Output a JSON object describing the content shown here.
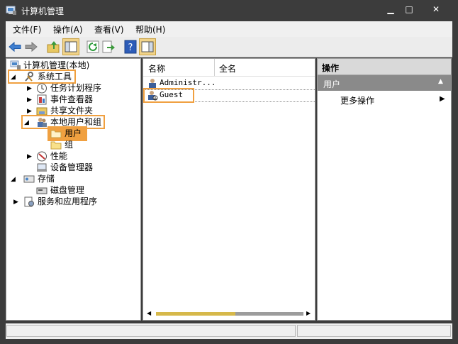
{
  "window": {
    "title": "计算机管理",
    "app_icon": "computer-management-icon",
    "minimize": "▁",
    "maximize": "□",
    "close": "✕"
  },
  "menubar": {
    "items": [
      "文件(F)",
      "操作(A)",
      "查看(V)",
      "帮助(H)"
    ]
  },
  "toolbar": {
    "icons": [
      "back-arrow-icon",
      "forward-arrow-icon",
      "up-folder-icon",
      "show-hide-tree-icon",
      "refresh-icon",
      "export-list-icon",
      "help-icon",
      "show-hide-action-pane-icon"
    ]
  },
  "tree": {
    "root": "计算机管理(本地)",
    "system_tools": "系统工具",
    "task_scheduler": "任务计划程序",
    "event_viewer": "事件查看器",
    "shared_folders": "共享文件夹",
    "local_users_groups": "本地用户和组",
    "users": "用户",
    "groups": "组",
    "performance": "性能",
    "device_manager": "设备管理器",
    "storage": "存储",
    "disk_management": "磁盘管理",
    "services_apps": "服务和应用程序"
  },
  "list": {
    "col_name": "名称",
    "col_fullname": "全名",
    "rows": [
      {
        "name": "Administr...",
        "icon": "user-icon"
      },
      {
        "name": "Guest",
        "icon": "disabled-user-icon"
      }
    ]
  },
  "actions": {
    "header": "操作",
    "section": "用户",
    "more": "更多操作"
  },
  "colors": {
    "highlight": "#f0a040",
    "scrollbar_thumb": "#d6b84a",
    "action_section": "#8a8a8a"
  }
}
